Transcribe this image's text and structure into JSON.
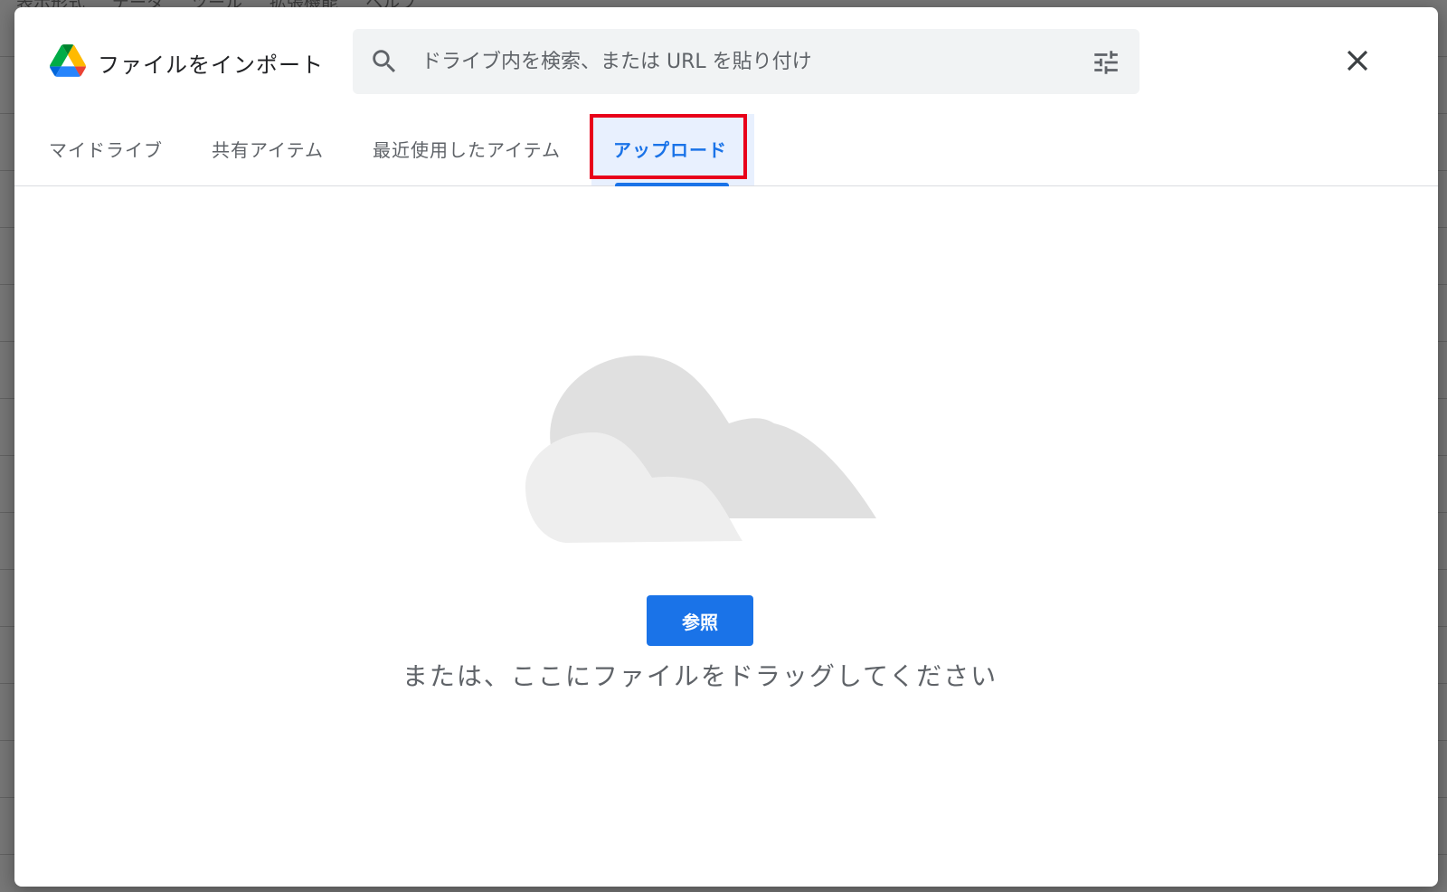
{
  "backdrop": {
    "menu_items": [
      "表示形式",
      "データ",
      "ツール",
      "拡張機能",
      "ヘルプ"
    ]
  },
  "dialog": {
    "title": "ファイルをインポート",
    "search": {
      "placeholder": "ドライブ内を検索、または URL を貼り付け",
      "value": ""
    },
    "icons": {
      "logo": "google-drive-logo",
      "search": "search-icon",
      "filter": "tune-icon",
      "close": "close-icon"
    },
    "tabs": [
      {
        "label": "マイドライブ",
        "active": false
      },
      {
        "label": "共有アイテム",
        "active": false
      },
      {
        "label": "最近使用したアイテム",
        "active": false
      },
      {
        "label": "アップロード",
        "active": true
      }
    ],
    "upload": {
      "browse_label": "参照",
      "drag_hint": "または、ここにファイルをドラッグしてください"
    }
  },
  "colors": {
    "accent": "#1a73e8",
    "highlight_box": "#e8001a",
    "cloud_back": "#e0e0e0",
    "cloud_front": "#eeeeee"
  }
}
